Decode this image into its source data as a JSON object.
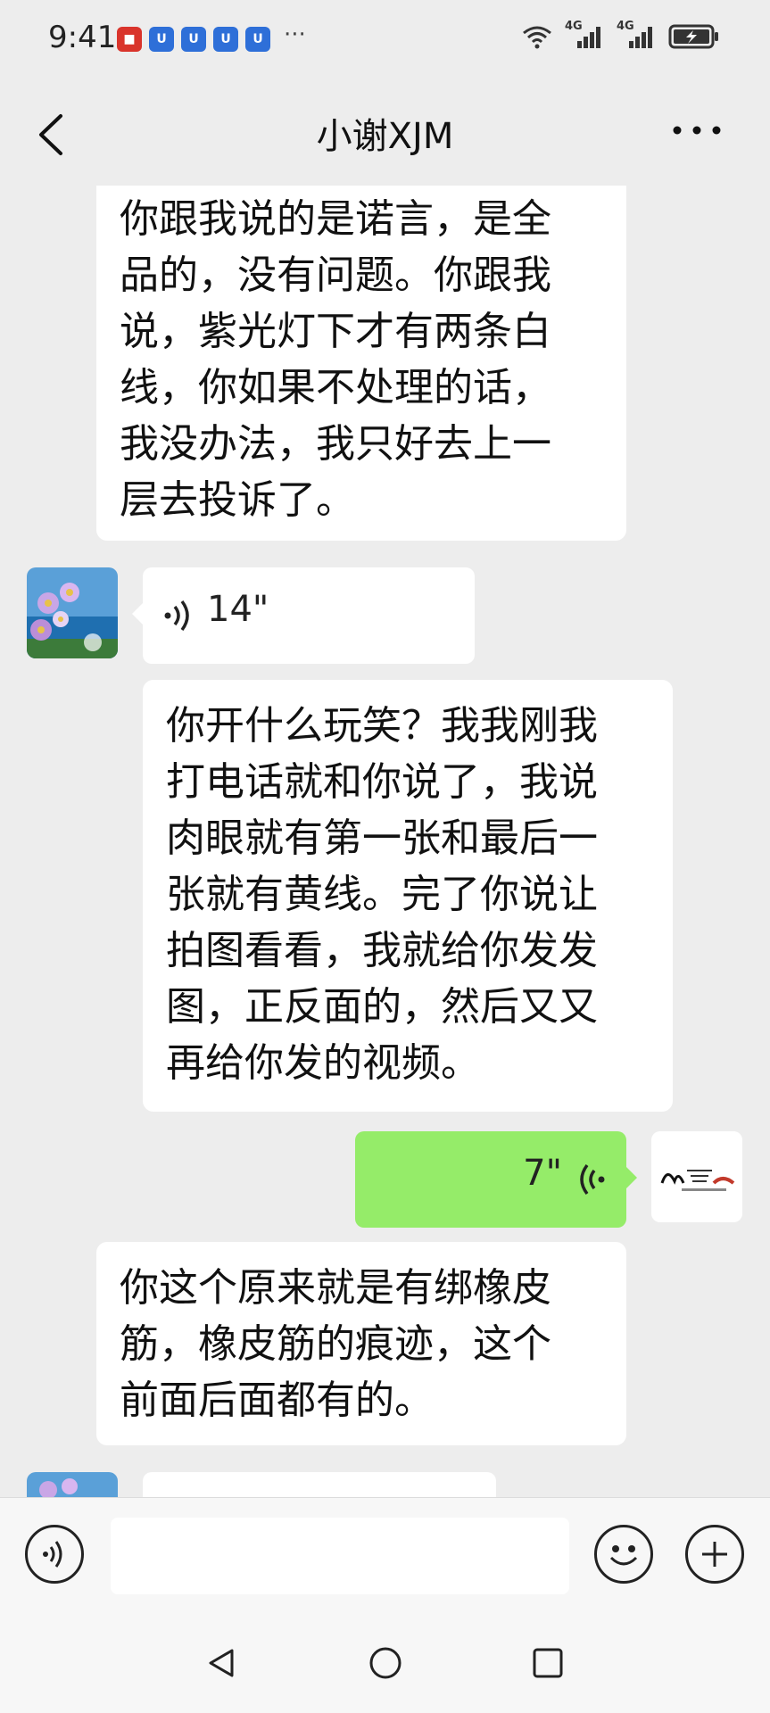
{
  "status_bar": {
    "time": "9:41",
    "notification_icons": [
      "app-red-icon",
      "app-blue-icon",
      "app-blue-icon",
      "app-blue-icon",
      "app-blue-icon"
    ],
    "more": "···",
    "signal_labels": [
      "4G",
      "4G"
    ]
  },
  "header": {
    "title": "小谢XJM",
    "back_icon": "chevron-left-icon",
    "more_icon": "ellipsis-icon"
  },
  "messages": [
    {
      "from": "other",
      "type": "text",
      "text": "你跟我说的是诺言，是全\n品的，没有问题。你跟我\n说，紫光灯下才有两条白\n线，你如果不处理的话，\n我没办法，我只好去上一\n层去投诉了。"
    },
    {
      "from": "other",
      "type": "voice",
      "duration": "14\""
    },
    {
      "from": "other",
      "type": "text",
      "text": "你开什么玩笑？我我刚我\n打电话就和你说了，我说\n肉眼就有第一张和最后一\n张就有黄线。完了你说让\n拍图看看，我就给你发发\n图，正反面的，然后又又\n再给你发的视频。"
    },
    {
      "from": "me",
      "type": "voice",
      "duration": "7\""
    },
    {
      "from": "other",
      "type": "text",
      "text": "你这个原来就是有绑橡皮\n筋，橡皮筋的痕迹，这个\n前面后面都有的。"
    }
  ],
  "input_bar": {
    "voice_icon": "voice-mode-icon",
    "emoji_icon": "emoji-icon",
    "plus_icon": "plus-icon",
    "placeholder": ""
  },
  "nav_bar": {
    "back": "nav-back-icon",
    "home": "nav-home-icon",
    "recent": "nav-recent-icon"
  },
  "colors": {
    "background": "#ededed",
    "my_bubble": "#95ec69",
    "their_bubble": "#ffffff"
  }
}
